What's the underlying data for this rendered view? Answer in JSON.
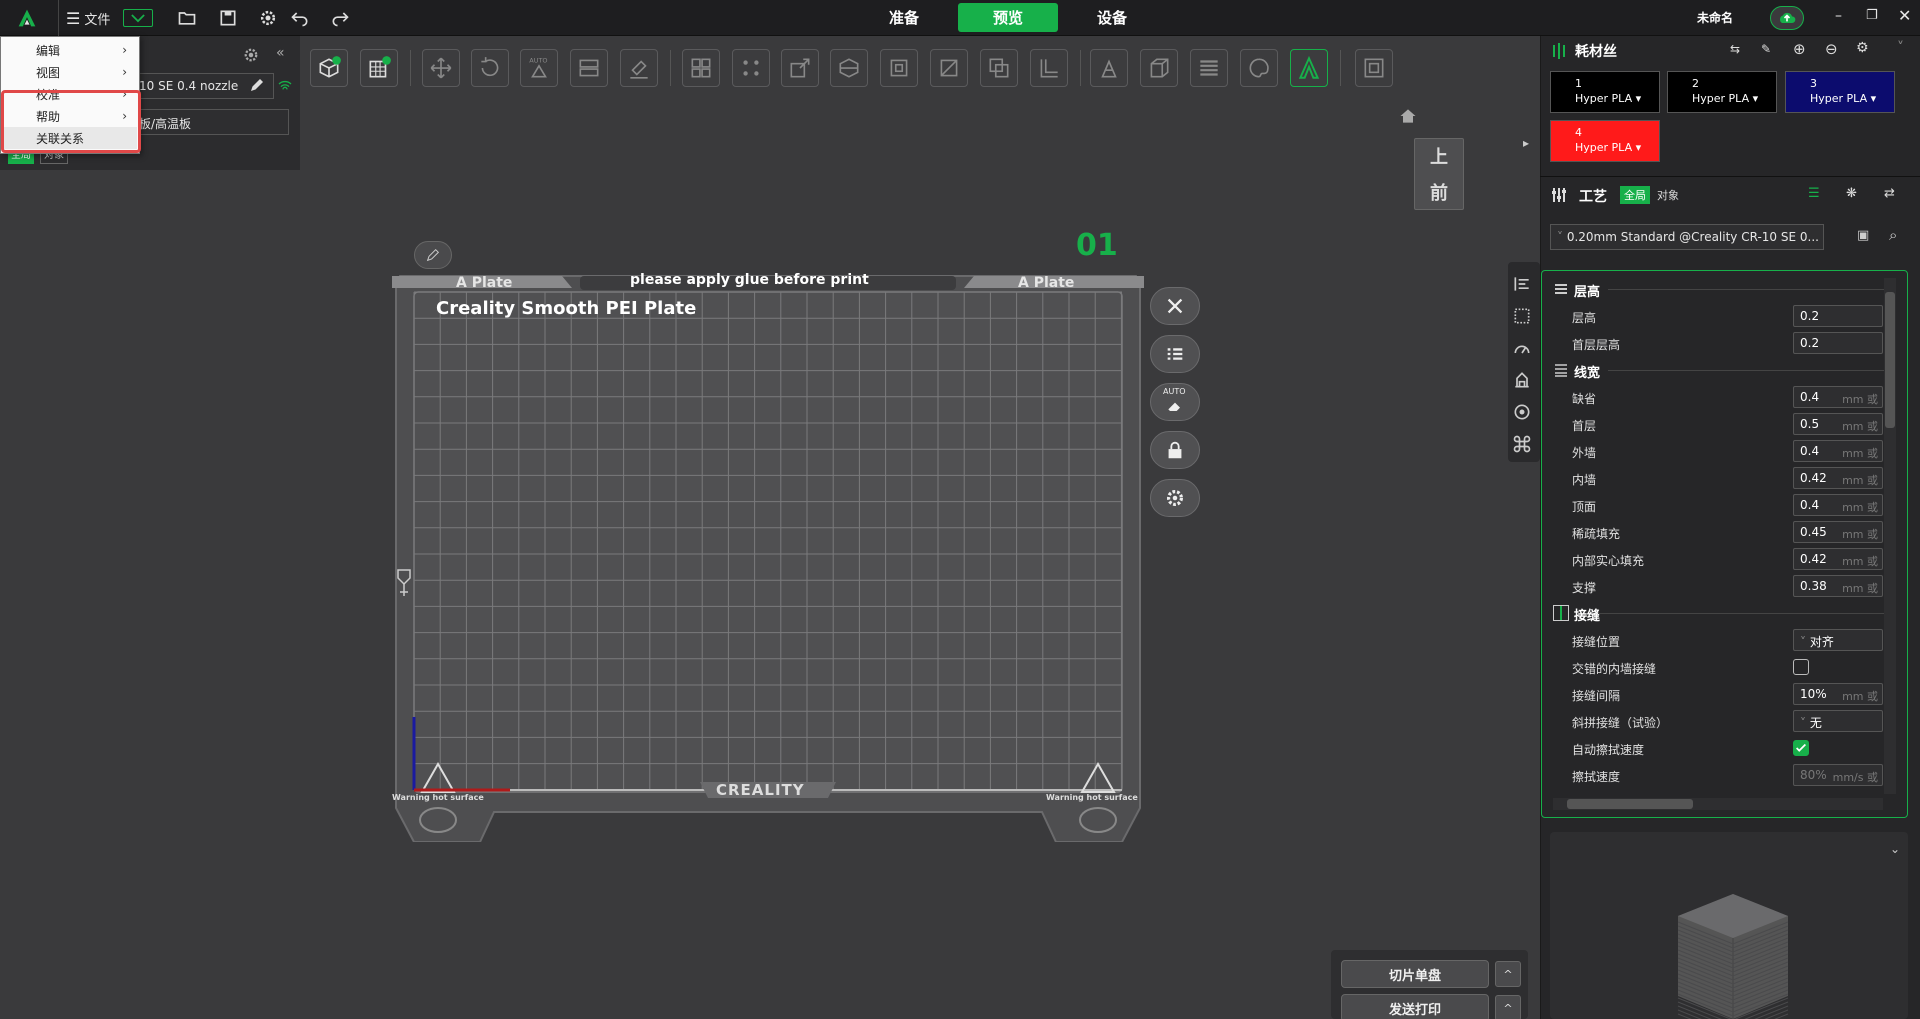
{
  "topbar": {
    "file_label": "文件",
    "tabs": [
      {
        "label": "准备"
      },
      {
        "label": "预览"
      },
      {
        "label": "设备"
      }
    ],
    "project_name": "未命名"
  },
  "menu": {
    "items": [
      {
        "label": "编辑",
        "has_sub": "›"
      },
      {
        "label": "视图",
        "has_sub": "›"
      },
      {
        "label": "校准",
        "has_sub": "›"
      },
      {
        "label": "帮助",
        "has_sub": "›"
      },
      {
        "label": "关联关系",
        "has_sub": ""
      }
    ]
  },
  "left": {
    "printer": "10 SE 0.4 nozzle",
    "plate_type": "板/高温板",
    "scope_global": "全局",
    "scope_object": "对象"
  },
  "view": {
    "top_label": "上",
    "front_label": "前",
    "plate_number": "01",
    "plate_left": "A Plate",
    "plate_right": "A Plate",
    "plate_notice": "please apply glue before print",
    "plate_name": "Creality Smooth PEI Plate",
    "brand": "CREALITY",
    "warn_left": "Warning hot surface",
    "warn_right": "Warning hot surface",
    "auto_label": "AUTO"
  },
  "filament": {
    "title": "耗材丝",
    "items": [
      {
        "num": "1",
        "name": "Hyper PLA",
        "color": "#000000"
      },
      {
        "num": "2",
        "name": "Hyper PLA",
        "color": "#000000"
      },
      {
        "num": "3",
        "name": "Hyper PLA",
        "color": "#0c0c6e"
      },
      {
        "num": "4",
        "name": "Hyper PLA",
        "color": "#ff1a1a"
      }
    ]
  },
  "process": {
    "title": "工艺",
    "global": "全局",
    "object": "对象",
    "preset": "0.20mm Standard @Creality CR-10 SE 0...",
    "groups": {
      "layer_height": "层高",
      "line_width": "线宽",
      "seam": "接缝"
    },
    "rows": {
      "layer_height": {
        "label": "层高",
        "value": "0.2"
      },
      "first_layer_height": {
        "label": "首层层高",
        "value": "0.2"
      },
      "default": {
        "label": "缺省",
        "value": "0.4",
        "unit": "mm 或"
      },
      "first_layer": {
        "label": "首层",
        "value": "0.5",
        "unit": "mm 或"
      },
      "outer_wall": {
        "label": "外墙",
        "value": "0.4",
        "unit": "mm 或"
      },
      "inner_wall": {
        "label": "内墙",
        "value": "0.42",
        "unit": "mm 或"
      },
      "top_surface": {
        "label": "顶面",
        "value": "0.4",
        "unit": "mm 或"
      },
      "sparse_infill": {
        "label": "稀疏填充",
        "value": "0.45",
        "unit": "mm 或"
      },
      "internal_solid": {
        "label": "内部实心填充",
        "value": "0.42",
        "unit": "mm 或"
      },
      "support": {
        "label": "支撑",
        "value": "0.38",
        "unit": "mm 或"
      },
      "seam_position": {
        "label": "接缝位置",
        "value": "对齐"
      },
      "staggered_seam": {
        "label": "交错的内墙接缝"
      },
      "seam_gap": {
        "label": "接缝间隔",
        "value": "10%",
        "unit": "mm 或"
      },
      "scarf_seam": {
        "label": "斜拼接缝（试验）",
        "value": "无"
      },
      "auto_wipe": {
        "label": "自动擦拭速度"
      },
      "wipe_speed": {
        "label": "擦拭速度",
        "value": "80%",
        "unit": "mm/s 或"
      }
    }
  },
  "bottom": {
    "slice": "切片单盘",
    "send": "发送打印"
  },
  "colors": {
    "accent": "#17b04a",
    "panel": "#262628",
    "canvas": "#3a3a3c"
  }
}
